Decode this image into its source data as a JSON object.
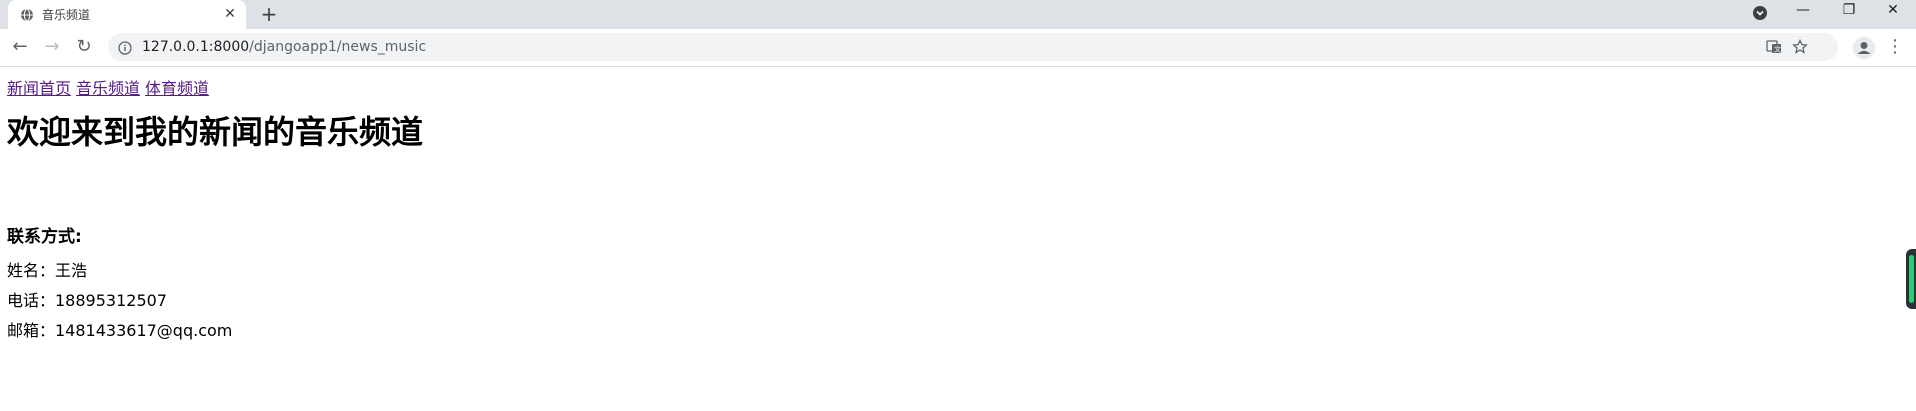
{
  "browser": {
    "tab": {
      "title": "音乐频道",
      "favicon": "globe-icon"
    },
    "address_bar": {
      "host": "127.0.0.1:8000",
      "path": "/djangoapp1/news_music"
    }
  },
  "page": {
    "nav_links": [
      "新闻首页",
      "音乐频道",
      "体育频道"
    ],
    "title": "欢迎来到我的新闻的音乐频道",
    "contact": {
      "heading": "联系方式:",
      "name": "姓名：王浩",
      "phone": "电话：18895312507",
      "email": "邮箱：1481433617@qq.com"
    }
  },
  "colors": {
    "visited_link": "#551a8b",
    "tabstrip_bg": "#dee1e6",
    "omnibox_bg": "#f1f3f4",
    "scroll_accent": "#2ecc71"
  }
}
